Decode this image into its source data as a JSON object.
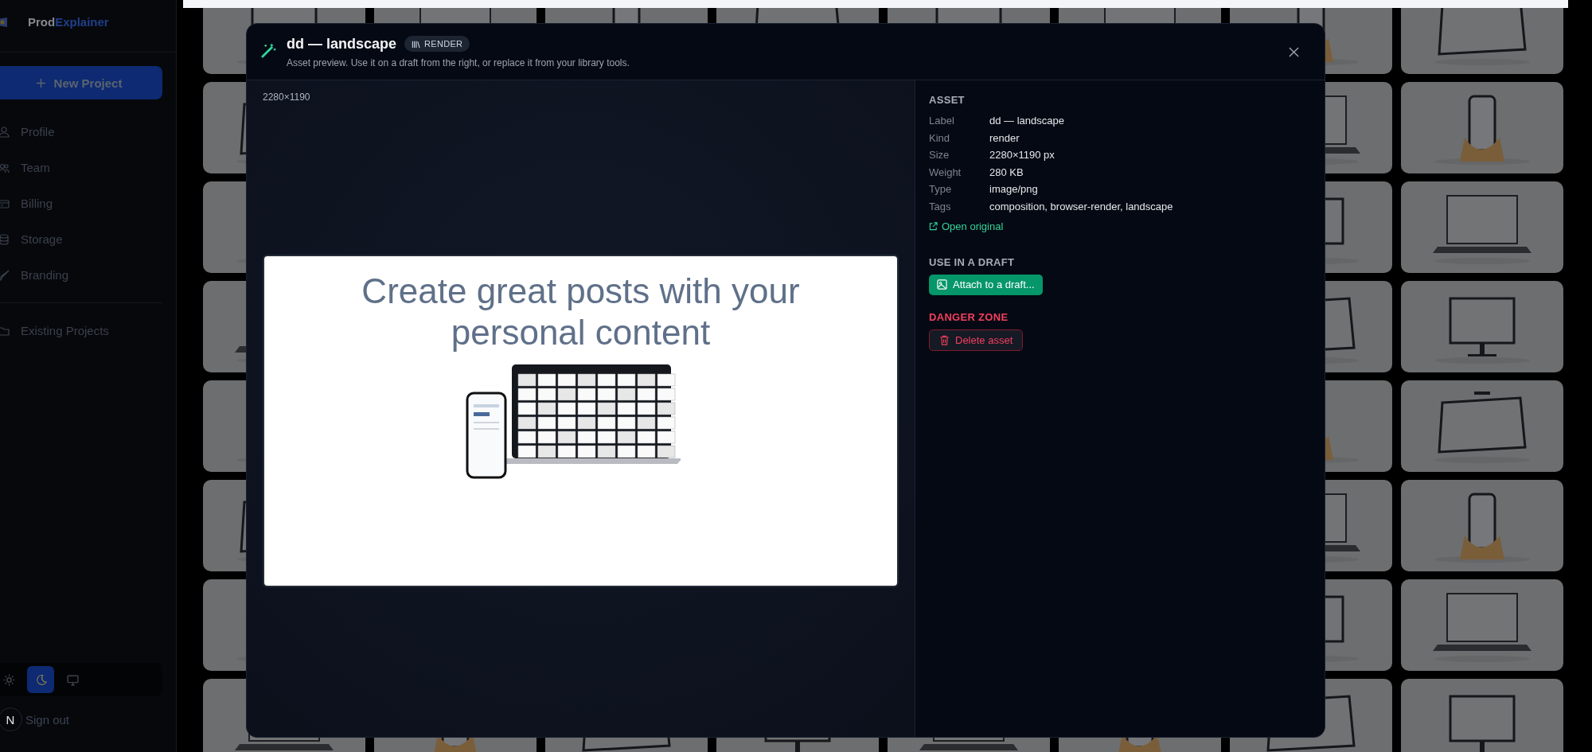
{
  "sidebar": {
    "brand": {
      "first": "Prod",
      "second": "Explainer"
    },
    "new_project": "New Project",
    "nav": [
      {
        "label": "Profile"
      },
      {
        "label": "Team"
      },
      {
        "label": "Billing"
      },
      {
        "label": "Storage"
      },
      {
        "label": "Branding"
      }
    ],
    "projects_link": "Existing Projects",
    "theme_options": [
      {
        "selected": false
      },
      {
        "selected": true
      },
      {
        "selected": false
      }
    ],
    "account": {
      "initial": "N",
      "action": "Sign out"
    }
  },
  "modal": {
    "title": "dd — landscape",
    "badge": "RENDER",
    "subtitle": "Asset preview. Use it on a draft from the right, or replace it from your library tools.",
    "dimensions": "2280×1190",
    "preview": {
      "headline": "Create great posts with your personal content"
    },
    "asset": {
      "heading": "ASSET",
      "fields": [
        {
          "label": "Label",
          "value": "dd — landscape"
        },
        {
          "label": "Kind",
          "value": "render"
        },
        {
          "label": "Size",
          "value": "2280×1190 px"
        },
        {
          "label": "Weight",
          "value": "280 KB"
        },
        {
          "label": "Type",
          "value": "image/png"
        },
        {
          "label": "Tags",
          "value": "composition, browser-render, landscape"
        }
      ],
      "link": "Open original"
    },
    "draft": {
      "heading": "USE IN A DRAFT",
      "button": "Attach to a draft..."
    },
    "danger": {
      "heading": "DANGER ZONE",
      "button": "Delete asset"
    }
  }
}
